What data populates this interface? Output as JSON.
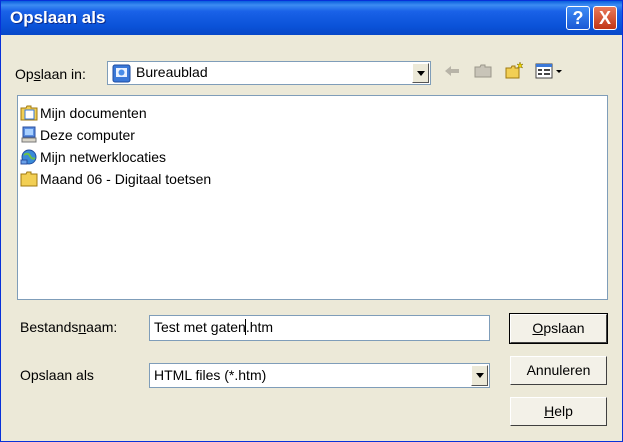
{
  "window": {
    "title": "Opslaan als"
  },
  "titlebar_buttons": {
    "help": "?",
    "close": "X"
  },
  "save_in": {
    "label_pre": "Op",
    "label_u": "s",
    "label_post": "laan in:",
    "value": "Bureaublad"
  },
  "toolbar": {
    "back_icon": "back-arrow-icon",
    "up_icon": "up-folder-icon",
    "new_folder_icon": "new-folder-icon",
    "view_icon": "view-menu-icon"
  },
  "file_list": {
    "items": [
      {
        "label": "Mijn documenten",
        "icon": "my-documents-icon"
      },
      {
        "label": "Deze computer",
        "icon": "computer-icon"
      },
      {
        "label": "Mijn netwerklocaties",
        "icon": "network-icon"
      },
      {
        "label": "Maand 06 - Digitaal toetsen",
        "icon": "folder-icon"
      }
    ]
  },
  "filename": {
    "label_pre": "Bestands",
    "label_u": "n",
    "label_post": "aam:",
    "value_pre": "Test met gaten",
    "value_post": ".htm"
  },
  "filetype": {
    "label": "Opslaan als",
    "value": "HTML files (*.htm)"
  },
  "buttons": {
    "save_u": "O",
    "save_rest": "pslaan",
    "cancel": "Annuleren",
    "help_u": "H",
    "help_rest": "elp"
  },
  "colors": {
    "title_bar": "#0a52d8",
    "dialog_bg": "#ece9d8",
    "close_red": "#c23516"
  }
}
